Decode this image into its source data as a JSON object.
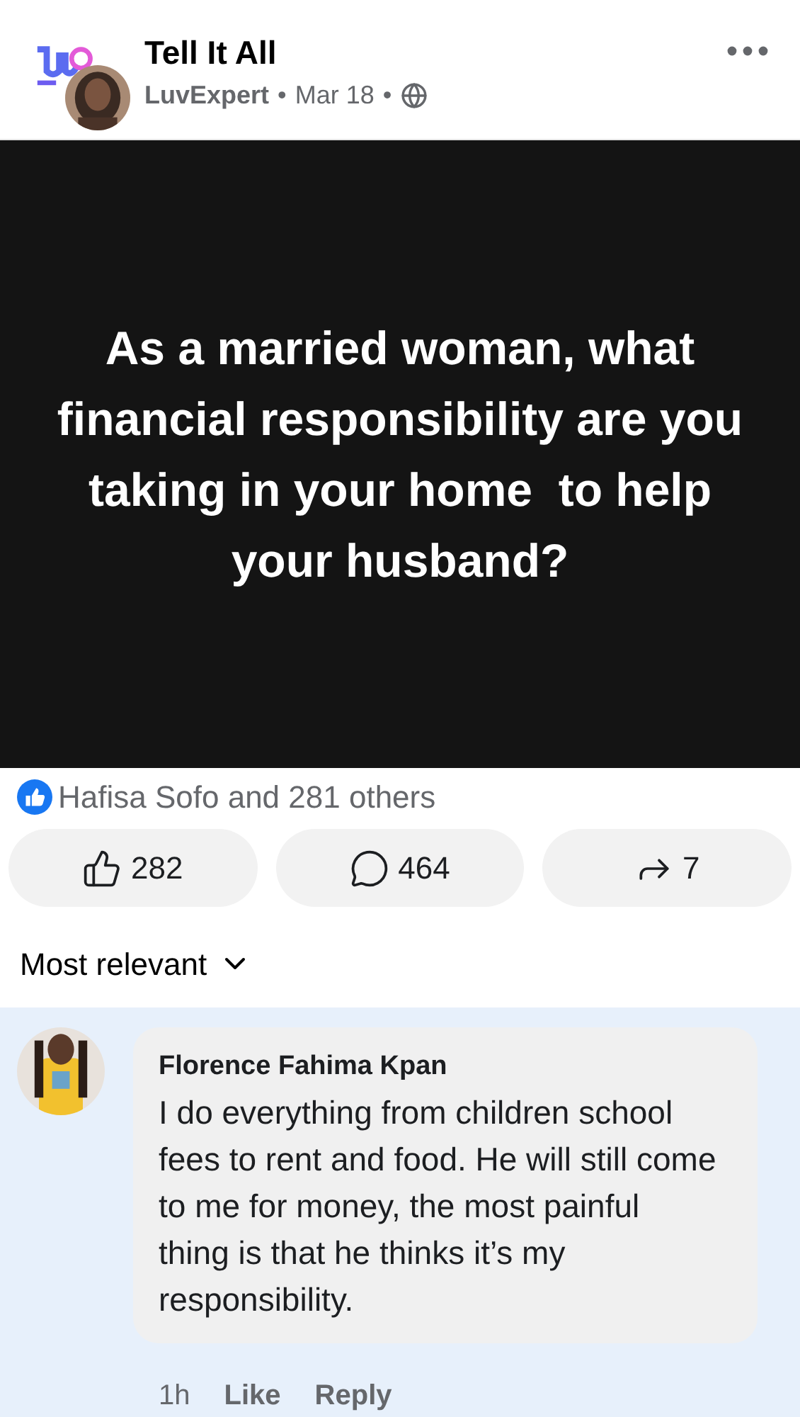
{
  "post": {
    "group": "Tell It All",
    "author": "LuvExpert",
    "separator": "•",
    "date": "Mar 18",
    "question": "As a married woman, what financial responsibility are you taking in your home  to help your husband?"
  },
  "reactions": {
    "summary": "Hafisa Sofo and 281 others"
  },
  "actions": [
    {
      "kind": "like",
      "count": "282"
    },
    {
      "kind": "comment",
      "count": "464"
    },
    {
      "kind": "share",
      "count": "7"
    }
  ],
  "sort": {
    "label": "Most relevant"
  },
  "comments": [
    {
      "author": "Florence Fahima Kpan",
      "text": "I do everything from children school fees to rent and food. He will still come to me for money, the most painful thing is that he thinks it’s my responsibility.",
      "time": "1h",
      "like": "Like",
      "reply": "Reply",
      "highlighted": true
    }
  ]
}
